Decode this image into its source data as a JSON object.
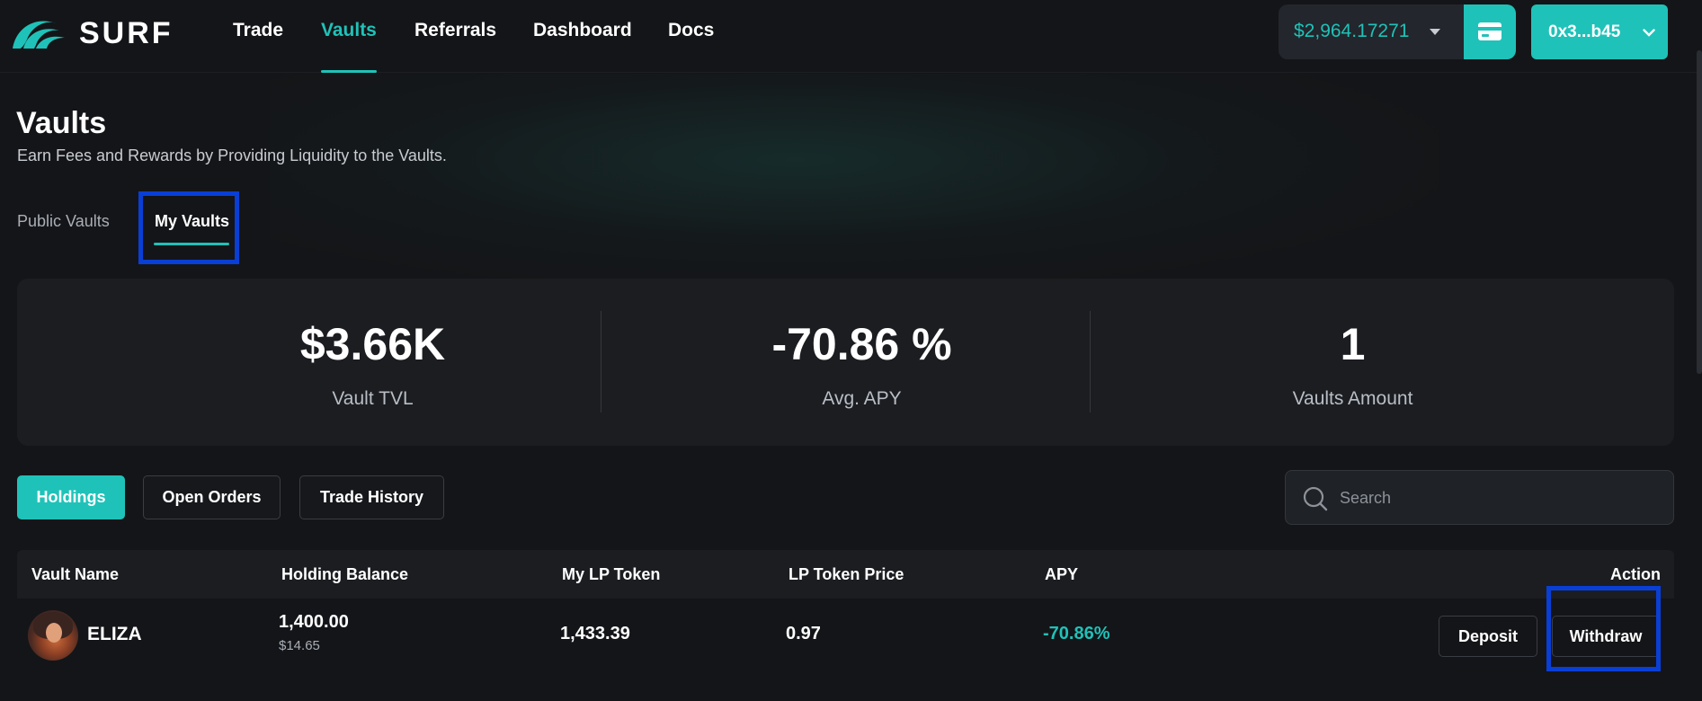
{
  "nav": {
    "brand": "SURF",
    "links": [
      "Trade",
      "Vaults",
      "Referrals",
      "Dashboard",
      "Docs"
    ],
    "active_link": "Vaults",
    "balance": "$2,964.17271",
    "address": "0x3...b45",
    "accent_color": "#1fc2b8"
  },
  "header": {
    "title": "Vaults",
    "subtitle": "Earn Fees and Rewards by Providing Liquidity to the Vaults."
  },
  "tabs": {
    "public": "Public Vaults",
    "mine": "My Vaults",
    "active": "My Vaults"
  },
  "stats": [
    {
      "value": "$3.66K",
      "label": "Vault TVL"
    },
    {
      "value": "-70.86 %",
      "label": "Avg. APY"
    },
    {
      "value": "1",
      "label": "Vaults Amount"
    }
  ],
  "filters": {
    "holdings": "Holdings",
    "open_orders": "Open Orders",
    "trade_history": "Trade History",
    "active": "Holdings"
  },
  "search": {
    "placeholder": "Search"
  },
  "table": {
    "columns": [
      "Vault Name",
      "Holding Balance",
      "My LP Token",
      "LP Token Price",
      "APY",
      "Action"
    ],
    "rows": [
      {
        "vault_name": "ELIZA",
        "holding_balance": "1,400.00",
        "holding_usd": "$14.65",
        "lp_token": "1,433.39",
        "lp_price": "0.97",
        "apy": "-70.86%",
        "deposit_label": "Deposit",
        "withdraw_label": "Withdraw"
      }
    ]
  }
}
